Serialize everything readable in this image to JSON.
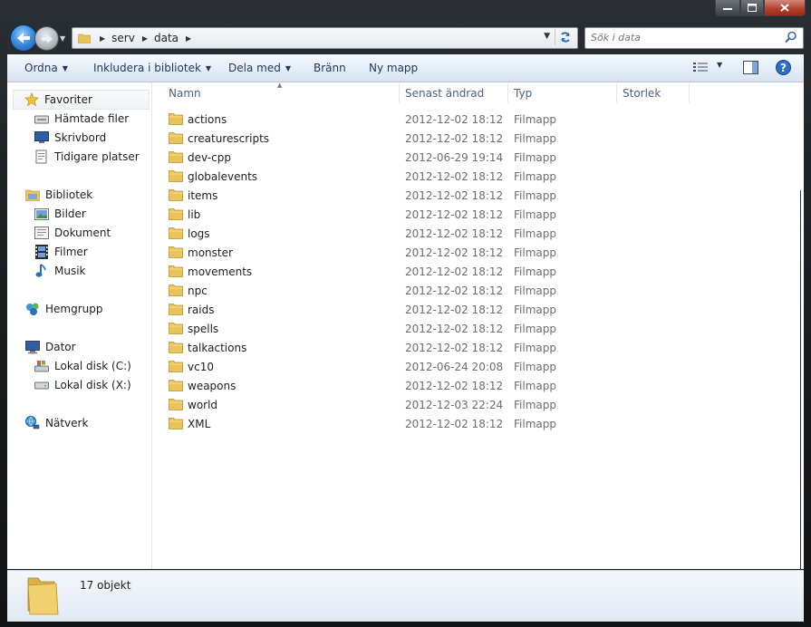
{
  "window": {
    "caption_buttons": [
      "minimize",
      "maximize",
      "close"
    ]
  },
  "navigation": {
    "breadcrumb": [
      "serv",
      "data"
    ],
    "search_placeholder": "Sök i data"
  },
  "toolbar": {
    "organize": "Ordna",
    "include_library": "Inkludera i bibliotek",
    "share_with": "Dela med",
    "burn": "Bränn",
    "new_folder": "Ny mapp"
  },
  "sidebar": {
    "favorites": {
      "label": "Favoriter",
      "items": [
        {
          "label": "Hämtade filer",
          "icon": "downloads-icon"
        },
        {
          "label": "Skrivbord",
          "icon": "desktop-icon"
        },
        {
          "label": "Tidigare platser",
          "icon": "recent-places-icon"
        }
      ]
    },
    "libraries": {
      "label": "Bibliotek",
      "items": [
        {
          "label": "Bilder",
          "icon": "pictures-icon"
        },
        {
          "label": "Dokument",
          "icon": "documents-icon"
        },
        {
          "label": "Filmer",
          "icon": "videos-icon"
        },
        {
          "label": "Musik",
          "icon": "music-icon"
        }
      ]
    },
    "homegroup": {
      "label": "Hemgrupp"
    },
    "computer": {
      "label": "Dator",
      "items": [
        {
          "label": "Lokal disk (C:)",
          "icon": "system-drive-icon"
        },
        {
          "label": "Lokal disk (X:)",
          "icon": "drive-icon"
        }
      ]
    },
    "network": {
      "label": "Nätverk"
    }
  },
  "columns": {
    "name": "Namn",
    "modified": "Senast ändrad",
    "type": "Typ",
    "size": "Storlek"
  },
  "files": [
    {
      "name": "actions",
      "modified": "2012-12-02 18:12",
      "type": "Filmapp"
    },
    {
      "name": "creaturescripts",
      "modified": "2012-12-02 18:12",
      "type": "Filmapp"
    },
    {
      "name": "dev-cpp",
      "modified": "2012-06-29 19:14",
      "type": "Filmapp"
    },
    {
      "name": "globalevents",
      "modified": "2012-12-02 18:12",
      "type": "Filmapp"
    },
    {
      "name": "items",
      "modified": "2012-12-02 18:12",
      "type": "Filmapp"
    },
    {
      "name": "lib",
      "modified": "2012-12-02 18:12",
      "type": "Filmapp"
    },
    {
      "name": "logs",
      "modified": "2012-12-02 18:12",
      "type": "Filmapp"
    },
    {
      "name": "monster",
      "modified": "2012-12-02 18:12",
      "type": "Filmapp"
    },
    {
      "name": "movements",
      "modified": "2012-12-02 18:12",
      "type": "Filmapp"
    },
    {
      "name": "npc",
      "modified": "2012-12-02 18:12",
      "type": "Filmapp"
    },
    {
      "name": "raids",
      "modified": "2012-12-02 18:12",
      "type": "Filmapp"
    },
    {
      "name": "spells",
      "modified": "2012-12-02 18:12",
      "type": "Filmapp"
    },
    {
      "name": "talkactions",
      "modified": "2012-12-02 18:12",
      "type": "Filmapp"
    },
    {
      "name": "vc10",
      "modified": "2012-06-24 20:08",
      "type": "Filmapp"
    },
    {
      "name": "weapons",
      "modified": "2012-12-02 18:12",
      "type": "Filmapp"
    },
    {
      "name": "world",
      "modified": "2012-12-03 22:24",
      "type": "Filmapp"
    },
    {
      "name": "XML",
      "modified": "2012-12-02 18:12",
      "type": "Filmapp"
    }
  ],
  "status": {
    "count": "17 objekt"
  },
  "colors": {
    "folder": "#e8c45a",
    "toolbar_text": "#1e395b",
    "header_text": "#4c607a",
    "meta_text": "#6d6d6d"
  }
}
